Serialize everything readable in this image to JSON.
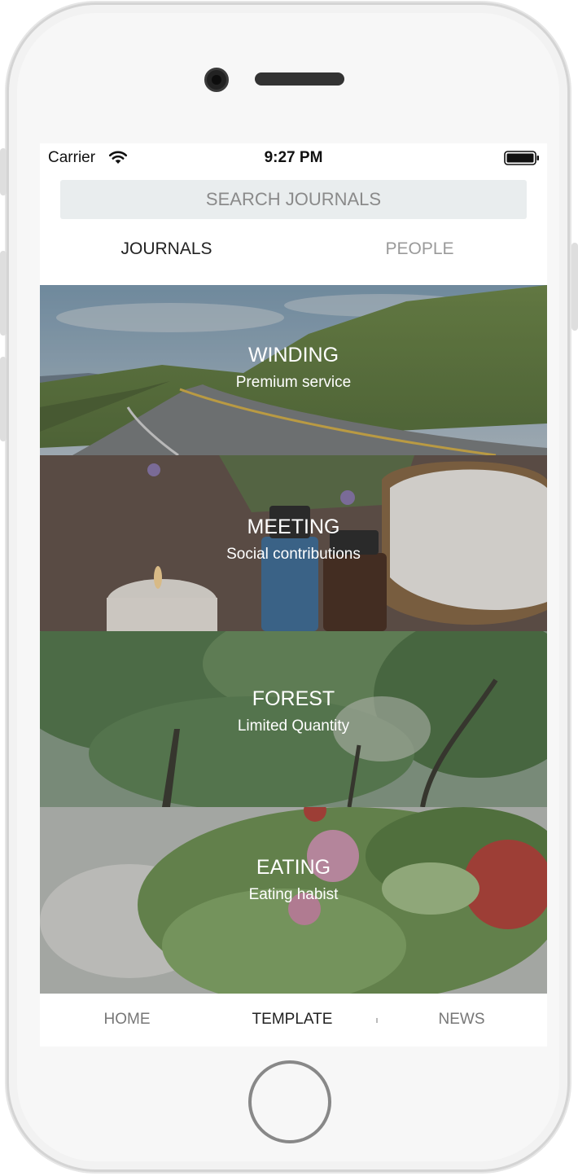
{
  "status_bar": {
    "carrier": "Carrier",
    "time": "9:27 PM",
    "wifi_icon": "wifi-icon",
    "battery_icon": "battery-full-icon"
  },
  "search": {
    "placeholder": "SEARCH JOURNALS"
  },
  "tabs": [
    {
      "label": "JOURNALS",
      "active": true
    },
    {
      "label": "PEOPLE",
      "active": false
    }
  ],
  "cards": [
    {
      "title": "WINDING",
      "subtitle": "Premium service",
      "image": "winding-road-photo"
    },
    {
      "title": "MEETING",
      "subtitle": "Social contributions",
      "image": "spa-candle-towel-photo"
    },
    {
      "title": "FOREST",
      "subtitle": "Limited Quantity",
      "image": "forest-trees-photo"
    },
    {
      "title": "EATING",
      "subtitle": "Eating habist",
      "image": "salad-photo"
    }
  ],
  "bottom_nav": [
    {
      "label": "HOME",
      "active": false
    },
    {
      "label": "TEMPLATE",
      "active": true
    },
    {
      "label": "NEWS",
      "active": false
    }
  ],
  "colors": {
    "search_bg": "#e9edee",
    "text_active": "#222222",
    "text_inactive": "#9a9a9a",
    "card_text": "#ffffff"
  }
}
